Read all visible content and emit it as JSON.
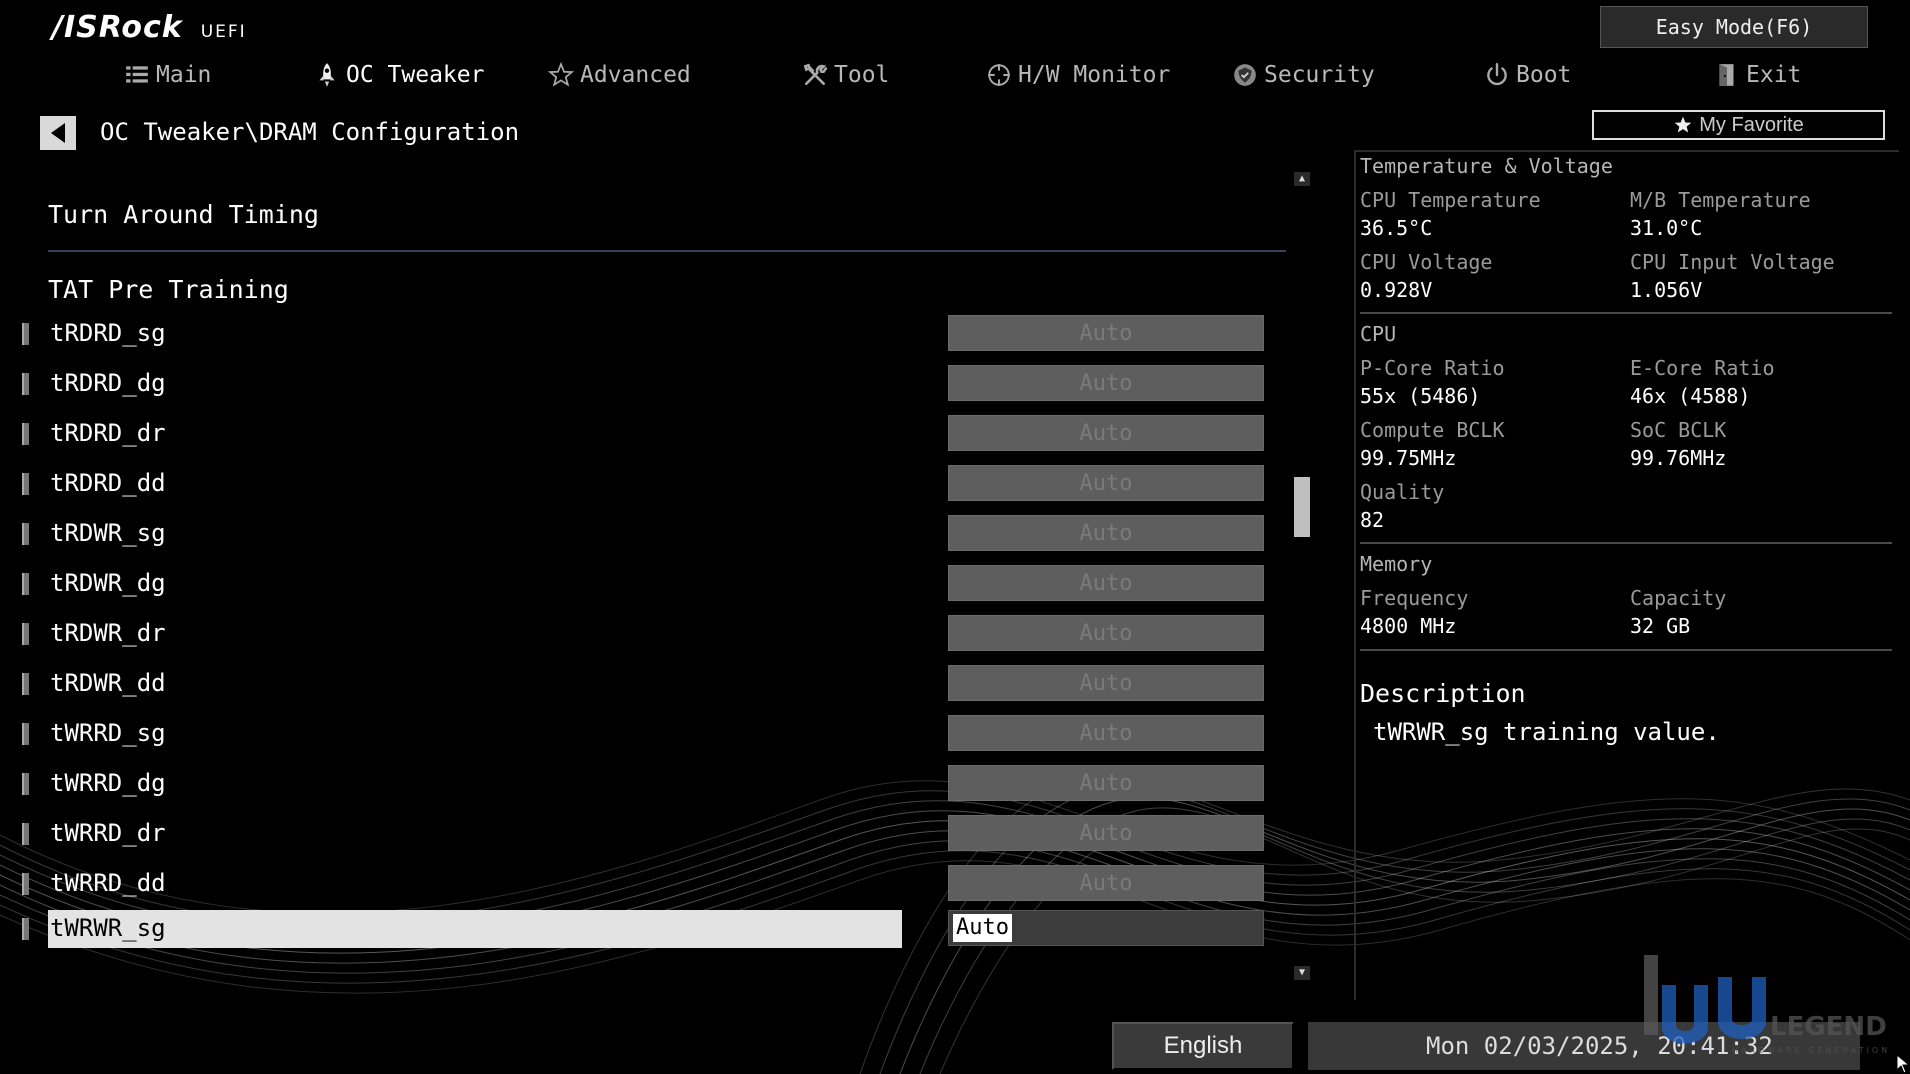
{
  "header": {
    "brand": "/ISRock",
    "uefi": "UEFI",
    "easy_mode": "Easy Mode(F6)"
  },
  "nav": {
    "tabs": [
      {
        "label": "Main",
        "icon": "list-icon"
      },
      {
        "label": "OC Tweaker",
        "icon": "rocket-icon",
        "active": true
      },
      {
        "label": "Advanced",
        "icon": "star-icon"
      },
      {
        "label": "Tool",
        "icon": "tools-icon"
      },
      {
        "label": "H/W Monitor",
        "icon": "crosshair-icon"
      },
      {
        "label": "Security",
        "icon": "shield-icon"
      },
      {
        "label": "Boot",
        "icon": "power-icon"
      },
      {
        "label": "Exit",
        "icon": "exit-door-icon"
      }
    ]
  },
  "breadcrumb": "OC Tweaker\\DRAM Configuration",
  "my_favorite": "My Favorite",
  "settings": {
    "section_title": "Turn Around Timing",
    "subsection_title": "TAT Pre Training",
    "rows": [
      {
        "label": "tRDRD_sg",
        "value": "Auto"
      },
      {
        "label": "tRDRD_dg",
        "value": "Auto"
      },
      {
        "label": "tRDRD_dr",
        "value": "Auto"
      },
      {
        "label": "tRDRD_dd",
        "value": "Auto"
      },
      {
        "label": "tRDWR_sg",
        "value": "Auto"
      },
      {
        "label": "tRDWR_dg",
        "value": "Auto"
      },
      {
        "label": "tRDWR_dr",
        "value": "Auto"
      },
      {
        "label": "tRDWR_dd",
        "value": "Auto"
      },
      {
        "label": "tWRRD_sg",
        "value": "Auto"
      },
      {
        "label": "tWRRD_dg",
        "value": "Auto"
      },
      {
        "label": "tWRRD_dr",
        "value": "Auto"
      },
      {
        "label": "tWRRD_dd",
        "value": "Auto"
      },
      {
        "label": "tWRWR_sg",
        "value": "Auto",
        "selected": true
      }
    ]
  },
  "info": {
    "temp_voltage_head": "Temperature & Voltage",
    "cpu_temp_label": "CPU Temperature",
    "cpu_temp_value": "36.5°C",
    "mb_temp_label": "M/B Temperature",
    "mb_temp_value": "31.0°C",
    "cpu_voltage_label": "CPU Voltage",
    "cpu_voltage_value": "0.928V",
    "cpu_input_voltage_label": "CPU Input Voltage",
    "cpu_input_voltage_value": "1.056V",
    "cpu_head": "CPU",
    "pcore_label": "P-Core Ratio",
    "pcore_value": "55x (5486)",
    "ecore_label": "E-Core Ratio",
    "ecore_value": "46x (4588)",
    "compute_bclk_label": "Compute BCLK",
    "compute_bclk_value": "99.75MHz",
    "soc_bclk_label": "SoC BCLK",
    "soc_bclk_value": "99.76MHz",
    "quality_label": "Quality",
    "quality_value": "82",
    "memory_head": "Memory",
    "frequency_label": "Frequency",
    "frequency_value": "4800 MHz",
    "capacity_label": "Capacity",
    "capacity_value": "32 GB",
    "description_title": "Description",
    "description_text": "tWRWR_sg training value."
  },
  "footer": {
    "language": "English",
    "datetime": "Mon 02/03/2025, 20:41:32"
  },
  "watermark": {
    "text": "LEGEND",
    "subtext": "HARDWARE GENERATION"
  }
}
